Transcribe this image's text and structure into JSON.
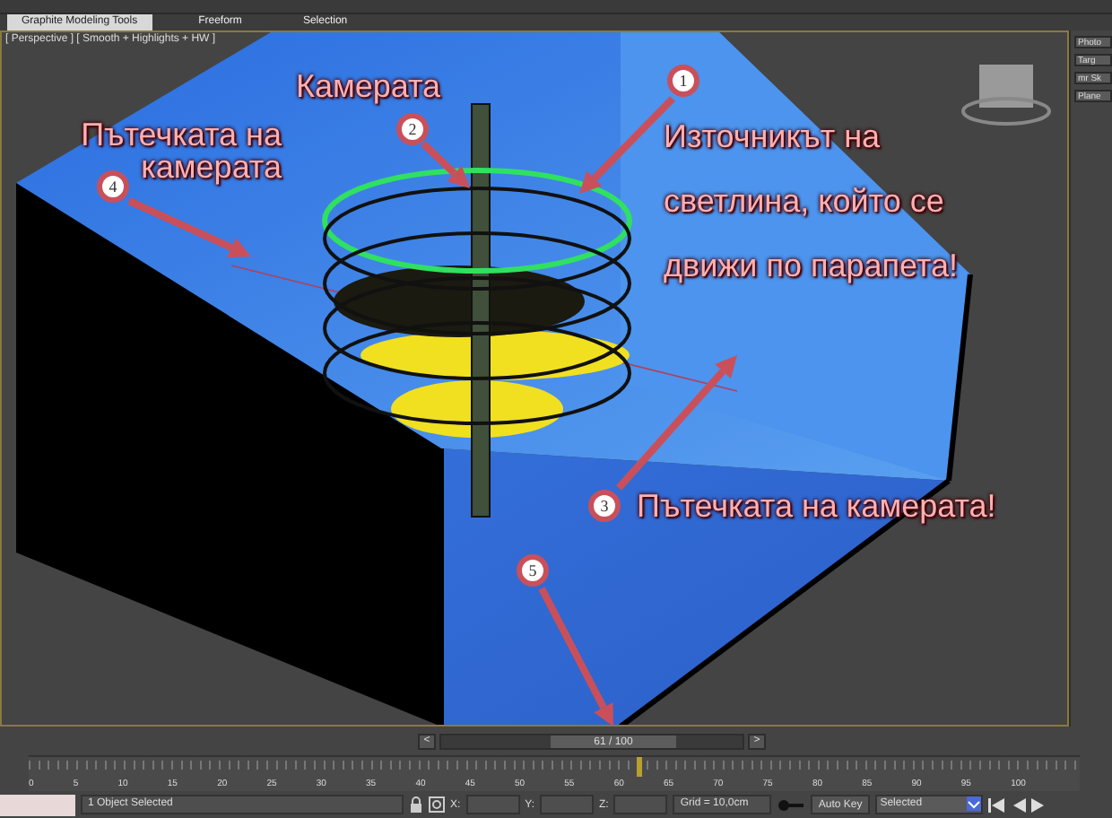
{
  "ribbon": {
    "tabs": [
      {
        "label": "Graphite Modeling Tools",
        "selected": true
      },
      {
        "label": "Freeform",
        "selected": false
      },
      {
        "label": "Selection",
        "selected": false
      }
    ]
  },
  "viewport": {
    "label": "[ Perspective ] [ Smooth + Highlights + HW ]",
    "annotations": [
      {
        "number": "2",
        "text": "Камерата"
      },
      {
        "number": "4",
        "text": "Пътечката на камерата"
      },
      {
        "number": "1",
        "text": "Източникът на светлина, който се движи по парапета!"
      },
      {
        "number": "3",
        "text": "Пътечката на камерата!"
      },
      {
        "number": "5"
      }
    ]
  },
  "command_panel": {
    "dropdown": "Photo",
    "buttons": [
      "Targ",
      "mr Sk"
    ],
    "second_button": "Plane"
  },
  "time_slider": {
    "prev": "<",
    "frame": "61 / 100",
    "next": ">",
    "level": 0.61
  },
  "track_bar": {
    "ticks": [
      "0",
      "5",
      "10",
      "15",
      "20",
      "25",
      "30",
      "35",
      "40",
      "45",
      "50",
      "55",
      "60",
      "65",
      "70",
      "75",
      "80",
      "85",
      "90",
      "95",
      "100"
    ],
    "level": 0.61
  },
  "status_bar": {
    "message": "1 Object Selected",
    "coords": [
      "X:",
      "Y:",
      "Z:"
    ],
    "grid": "Grid = 10,0cm",
    "auto_key": "Auto Key",
    "key_filter": "Selected"
  }
}
